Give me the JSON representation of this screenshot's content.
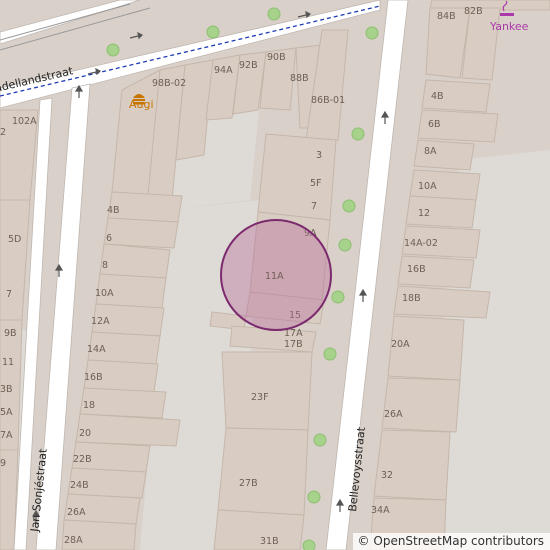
{
  "streets": {
    "bellevoy": "Bellevoysstraat",
    "sonje": "Jan Sonjéstraat",
    "top": "adellandstraat"
  },
  "pois": {
    "augi": "Augi",
    "yankee": "Yankee"
  },
  "marker_label": "11A",
  "house_numbers": {
    "n98b02": "98B-02",
    "n94a": "94A",
    "n92b": "92B",
    "n90b": "90B",
    "n88b": "88B",
    "n86b01": "86B-01",
    "n102a": "102A",
    "n2": "2",
    "n5d": "5D",
    "n7l": "7",
    "n9b": "9B",
    "n11l": "11",
    "n13b": "3B",
    "n15a": "5A",
    "n17al": "7A",
    "n19l": "9",
    "c4b": "4B",
    "c6": "6",
    "c8": "8",
    "c10a": "10A",
    "c12a": "12A",
    "c14a": "14A",
    "c16b": "16B",
    "c18": "18",
    "c20": "20",
    "c22b": "22B",
    "c24b": "24B",
    "c26a": "26A",
    "c28a": "28A",
    "m3": "3",
    "m5f": "5F",
    "m7": "7",
    "m9a": "9A",
    "m15": "15",
    "m17a": "17A",
    "m17b": "17B",
    "m23f": "23F",
    "m27b": "27B",
    "m31b": "31B",
    "r84b": "84B",
    "r82b": "82B",
    "r4b": "4B",
    "r6b": "6B",
    "r8a": "8A",
    "r10a": "10A",
    "r12": "12",
    "r14a02": "14A-02",
    "r16b": "16B",
    "r18b": "18B",
    "r20a": "20A",
    "r26a": "26A",
    "r32": "32",
    "r34a": "34A"
  },
  "attribution": {
    "copyright": "©",
    "link": "OpenStreetMap contributors"
  },
  "colors": {
    "land": "#d9d0c9",
    "building": "#d9cdc3",
    "road": "#ffffff",
    "marker_fill": "#b86b9c",
    "marker_stroke": "#7c2a6e",
    "tree": "#a7d28c",
    "poi_food": "#c77400",
    "poi_shop": "#ac39ac",
    "footpath": "#1e3cb4"
  }
}
